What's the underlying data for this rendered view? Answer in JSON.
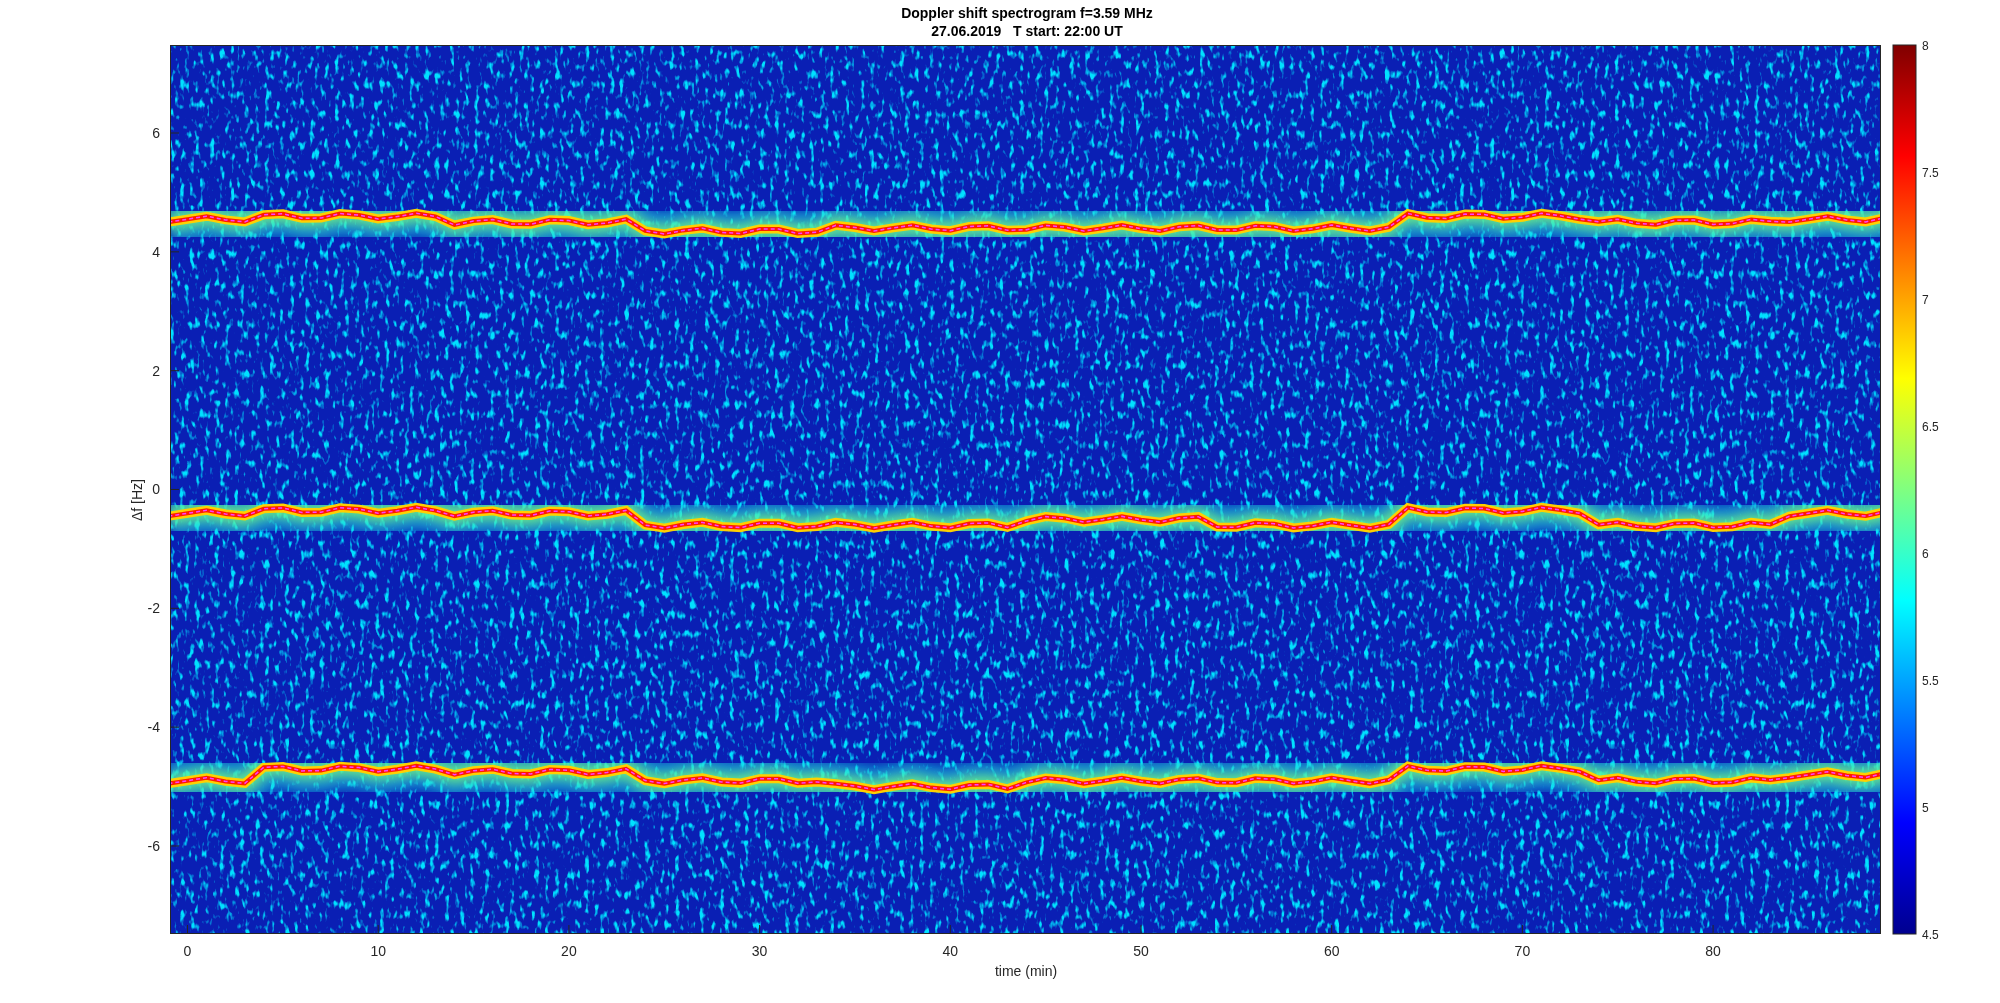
{
  "figure": {
    "title": [
      "Doppler shift spectrogram f=3.59 MHz",
      "27.06.2019   T start: 22:00 UT"
    ],
    "xlabel": "time (min)",
    "ylabel": "Δf [Hz]",
    "xticks": [
      "0",
      "10",
      "20",
      "30",
      "40",
      "50",
      "60",
      "70",
      "80"
    ],
    "yticks": [
      "6",
      "4",
      "2",
      "0",
      "-2",
      "-4",
      "-6"
    ],
    "colorbar": {
      "ticks": [
        "8",
        "7.5",
        "7",
        "6.5",
        "6",
        "5.5",
        "5",
        "4.5"
      ]
    }
  }
}
